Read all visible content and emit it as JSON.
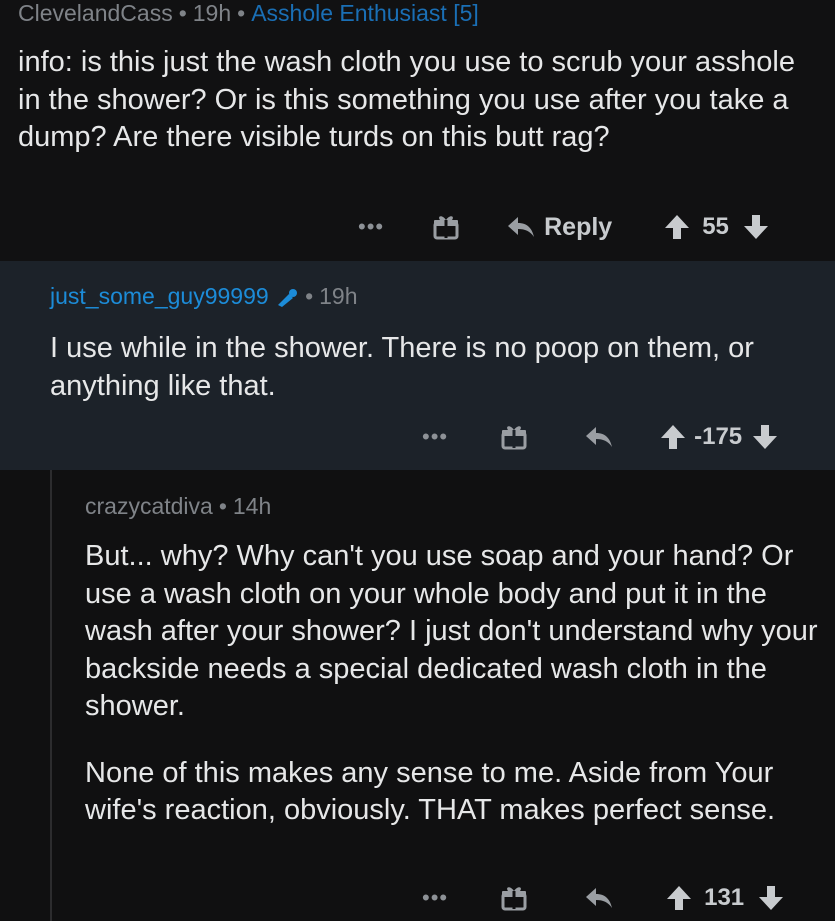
{
  "comments": [
    {
      "author": "ClevelandCass",
      "age": "19h",
      "flair": "Asshole Enthusiast [5]",
      "body": "info: is this just the wash cloth you use to scrub your asshole in the shower? Or is this something you use after you take a dump? Are there visible turds on this butt rag?",
      "actions": {
        "more": "•••",
        "reply": "Reply",
        "score": "55"
      }
    },
    {
      "author": "just_some_guy99999",
      "age": "19h",
      "body": "I use while in the shower. There is no poop on them, or anything like that.",
      "actions": {
        "more": "•••",
        "score": "-175"
      }
    },
    {
      "author": "crazycatdiva",
      "age": "14h",
      "body_paragraphs": [
        "But... why? Why can't you use soap and your hand? Or use a wash cloth on your whole body and put it in the wash after your shower? I just don't understand why your backside needs a special dedicated wash cloth in the shower.",
        "None of this makes any sense to me. Aside from Your wife's reaction, obviously. THAT makes perfect sense."
      ],
      "actions": {
        "more": "•••",
        "score": "131"
      }
    }
  ],
  "icons": [
    "gift-icon",
    "reply-arrow-icon",
    "upvote-icon",
    "downvote-icon",
    "more-icon",
    "op-icon"
  ],
  "colors": {
    "link_blue": "#1c8cd8",
    "selected_bg": "#1c2229",
    "bg": "#111112"
  }
}
